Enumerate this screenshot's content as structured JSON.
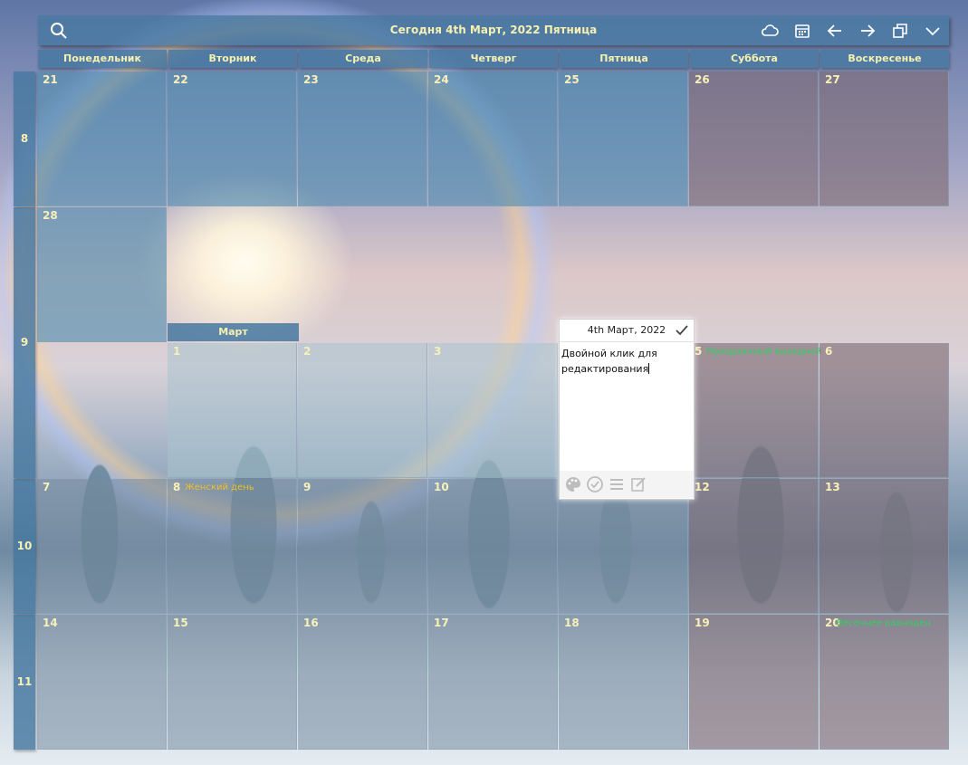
{
  "toolbar": {
    "title": "Сегодня 4th Март, 2022 Пятница"
  },
  "day_headers": [
    "Понедельник",
    "Вторник",
    "Среда",
    "Четверг",
    "Пятница",
    "Суббота",
    "Воскресенье"
  ],
  "weeks": [
    "8",
    "9",
    "10",
    "11"
  ],
  "month_label": "Март",
  "days": {
    "d21": "21",
    "d22": "22",
    "d23": "23",
    "d24": "24",
    "d25": "25",
    "d26": "26",
    "d27": "27",
    "d28": "28",
    "d1": "1",
    "d2": "2",
    "d3": "3",
    "d5": "5",
    "d6": "6",
    "d7": "7",
    "d8": "8",
    "d9": "9",
    "d10": "10",
    "d12": "12",
    "d13": "13",
    "d14": "14",
    "d15": "15",
    "d16": "16",
    "d17": "17",
    "d18": "18",
    "d19": "19",
    "d20": "20"
  },
  "holidays": {
    "womens_day": "Женский день",
    "mar5": "Праздничный выходной",
    "equinox": "Весеннее равноден"
  },
  "popup": {
    "date": "4th Март, 2022",
    "text_line1": "Двойной клик для",
    "text_line2": "редактирования"
  },
  "colors": {
    "header_text": "#f7f0b0",
    "holiday_yellow": "#f0c020",
    "holiday_green": "#2fd060"
  }
}
